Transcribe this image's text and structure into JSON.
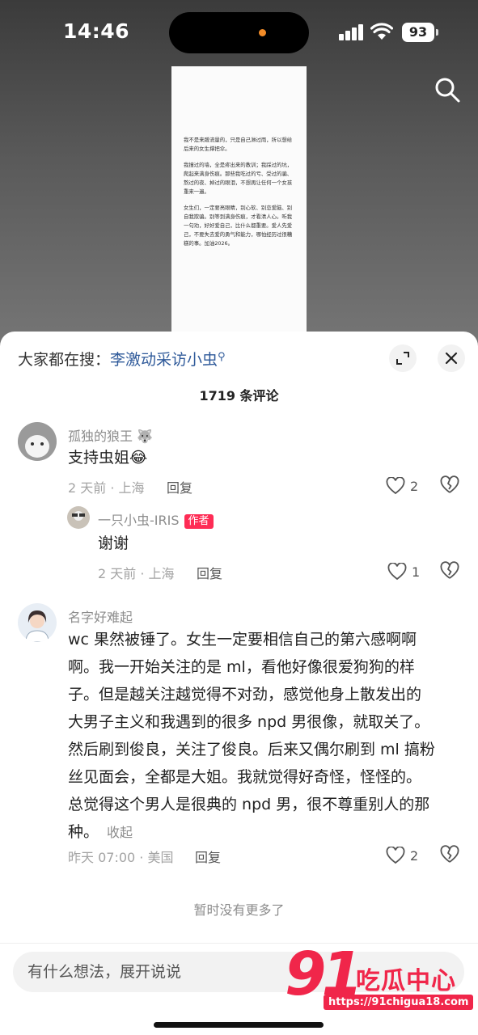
{
  "status_bar": {
    "time": "14:46",
    "battery": "93"
  },
  "preview": {
    "paragraphs": [
      "我不是来蹭流量的，只是自己淋过雨，所以想给后来的女生撑把伞。",
      "我撞过的墙，全是疼出来的教训；我踩过的坑，爬起来满身伤痕。那些我吃过的亏、受过的骗、熬过的夜、掉过的眼泪，不想再让任何一个女孩重来一遍。",
      "女生们，一定要亮眼睛，别心软、别恋爱脑、别自我欺骗。别等到满身伤痕，才看清人心。听我一句劝，好好爱自己，比什么都重要。爱人先爱己，不要失去爱的勇气和能力，哪怕经历过很糟糕的事。加油2026。"
    ]
  },
  "sheet": {
    "hot_search_prefix": "大家都在搜：",
    "hot_search_keyword": "李激动采访小虫",
    "comment_count": "1719 条评论",
    "no_more": "暂时没有更多了",
    "input_placeholder": "有什么想法，展开说说"
  },
  "comments": [
    {
      "user": "孤独的狼王",
      "user_emoji": "🐺",
      "text": "支持虫姐",
      "emoji": "😂",
      "time": "2 天前 · 上海",
      "reply": "回复",
      "likes": "2"
    },
    {
      "user": "一只小虫-IRIS",
      "badge": "作者",
      "text": "谢谢",
      "time": "2 天前 · 上海",
      "reply": "回复",
      "likes": "1"
    },
    {
      "user": "名字好难起",
      "lines": [
        "wc 果然被锤了。女生一定要相信自己的第六感啊啊",
        "啊。我一开始关注的是 ml，看他好像很爱狗狗的样",
        "子。但是越关注越觉得不对劲，感觉他身上散发出的",
        "大男子主义和我遇到的很多 npd 男很像，就取关了。",
        "然后刷到俊良，关注了俊良。后来又偶尔刷到 ml 搞粉",
        "丝见面会，全都是大姐。我就觉得好奇怪，怪怪的。",
        "总觉得这个男人是很典的 npd 男，很不尊重别人的那",
        "种。"
      ],
      "collapse": "收起",
      "time": "昨天 07:00 · 美国",
      "reply": "回复",
      "likes": "2"
    }
  ],
  "watermark": {
    "logo": "91",
    "name": "吃瓜中心",
    "url": "https://91chigua18.com"
  },
  "colors": {
    "accent": "#fe2c55",
    "link": "#2f5a9a",
    "watermark": "#f0264a"
  }
}
